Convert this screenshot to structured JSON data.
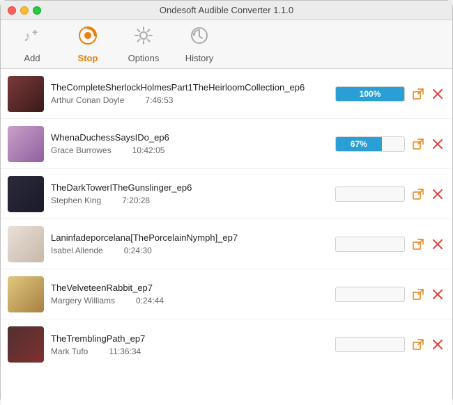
{
  "app": {
    "title": "Ondesoft Audible Converter 1.1.0"
  },
  "toolbar": {
    "buttons": [
      {
        "id": "add",
        "label": "Add",
        "icon": "➕",
        "active": false
      },
      {
        "id": "stop",
        "label": "Stop",
        "icon": "⏺",
        "active": true
      },
      {
        "id": "options",
        "label": "Options",
        "icon": "⚙️",
        "active": false
      },
      {
        "id": "history",
        "label": "History",
        "icon": "🕐",
        "active": false
      }
    ]
  },
  "items": [
    {
      "id": 1,
      "title": "TheCompleteSherlockHolmesPart1TheHeirloomCollection_ep6",
      "author": "Arthur Conan Doyle",
      "duration": "7:46:53",
      "progress": 100,
      "thumb_class": "thumb-1"
    },
    {
      "id": 2,
      "title": "WhenaDuchessSaysIDo_ep6",
      "author": "Grace Burrowes",
      "duration": "10:42:05",
      "progress": 67,
      "thumb_class": "thumb-2"
    },
    {
      "id": 3,
      "title": "TheDarkTowerITheGunslinger_ep6",
      "author": "Stephen King",
      "duration": "7:20:28",
      "progress": 0,
      "thumb_class": "thumb-3"
    },
    {
      "id": 4,
      "title": "Laninfadeporcelana[ThePorcelainNymph]_ep7",
      "author": "Isabel Allende",
      "duration": "0:24:30",
      "progress": 0,
      "thumb_class": "thumb-4"
    },
    {
      "id": 5,
      "title": "TheVelveteenRabbit_ep7",
      "author": "Margery Williams",
      "duration": "0:24:44",
      "progress": 0,
      "thumb_class": "thumb-5"
    },
    {
      "id": 6,
      "title": "TheTremblingPath_ep7",
      "author": "Mark Tufo",
      "duration": "11:36:34",
      "progress": 0,
      "thumb_class": "thumb-6"
    }
  ],
  "actions": {
    "open_label": "🔗",
    "delete_label": "✕"
  }
}
